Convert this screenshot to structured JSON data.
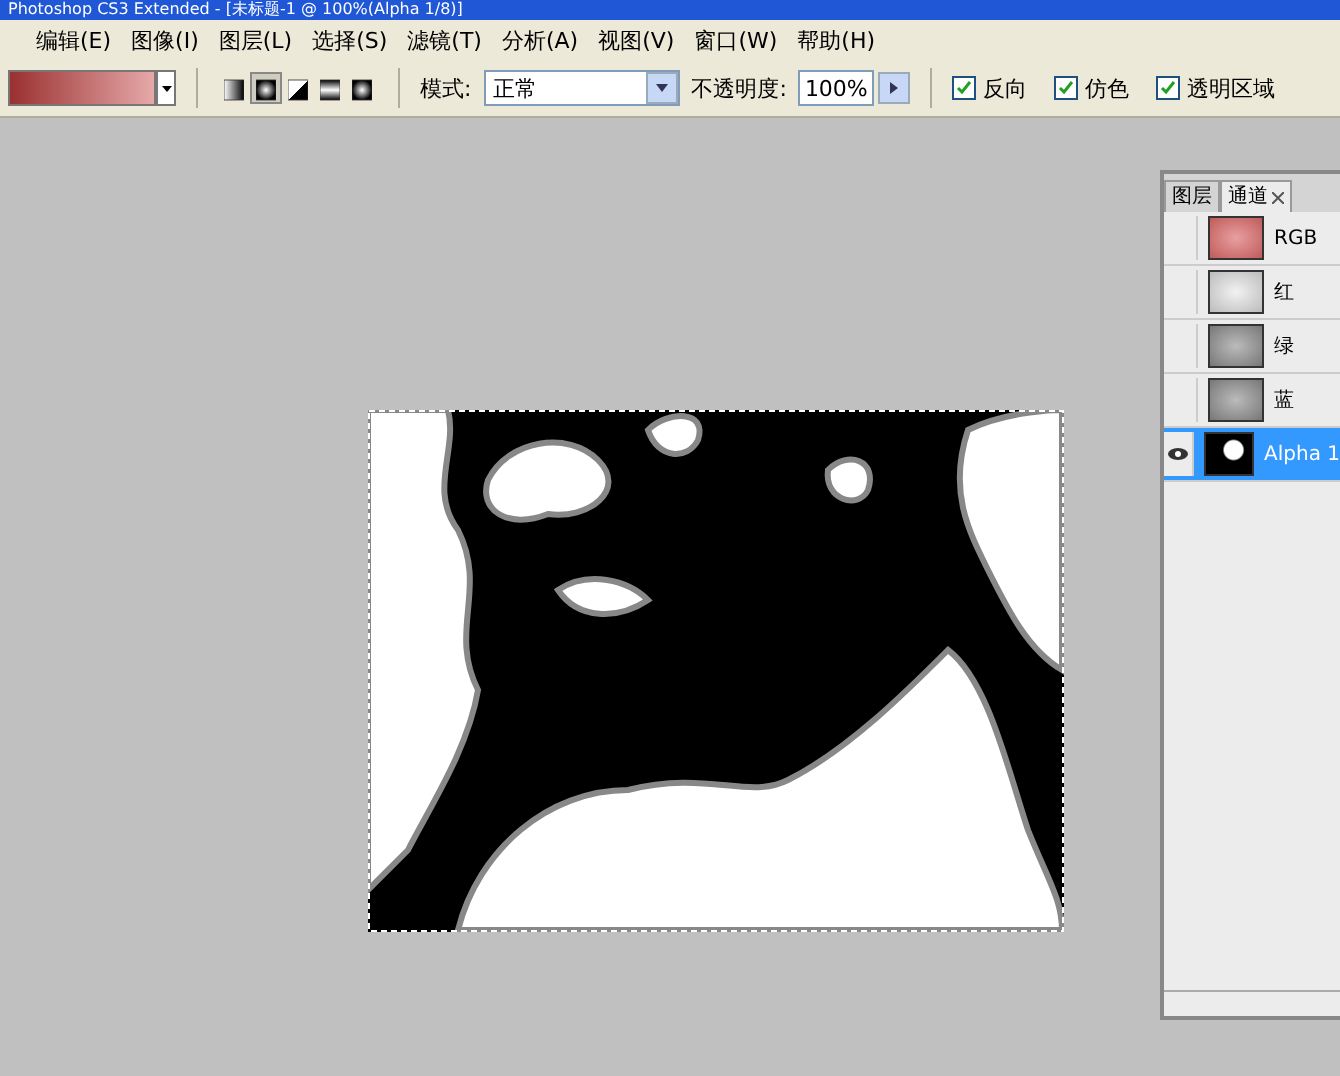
{
  "window": {
    "title": "Photoshop CS3 Extended - [未标题-1 @ 100%(Alpha 1/8)]"
  },
  "menu": [
    "编辑(E)",
    "图像(I)",
    "图层(L)",
    "选择(S)",
    "滤镜(T)",
    "分析(A)",
    "视图(V)",
    "窗口(W)",
    "帮助(H)"
  ],
  "options": {
    "gradient_types": [
      {
        "kind": "linear",
        "selected": false
      },
      {
        "kind": "radial",
        "selected": true
      },
      {
        "kind": "angle",
        "selected": false
      },
      {
        "kind": "reflected",
        "selected": false
      },
      {
        "kind": "diamond",
        "selected": false
      }
    ],
    "mode_label": "模式:",
    "mode": "正常",
    "opacity_label": "不透明度:",
    "opacity": "100%",
    "checkboxes": [
      {
        "label": "反向",
        "checked": true
      },
      {
        "label": "仿色",
        "checked": true
      },
      {
        "label": "透明区域",
        "checked": true
      }
    ]
  },
  "panel": {
    "tabs": [
      {
        "label": "图层",
        "selected": false
      },
      {
        "label": "通道",
        "selected": true,
        "closable": true
      }
    ],
    "channels": [
      {
        "name": "RGB",
        "kind": "rgb",
        "visible": false,
        "selected": false
      },
      {
        "name": "红",
        "kind": "light",
        "visible": false,
        "selected": false
      },
      {
        "name": "绿",
        "kind": "mid",
        "visible": false,
        "selected": false
      },
      {
        "name": "蓝",
        "kind": "mid",
        "visible": false,
        "selected": false
      },
      {
        "name": "Alpha 1",
        "kind": "mask",
        "visible": true,
        "selected": true
      }
    ]
  }
}
